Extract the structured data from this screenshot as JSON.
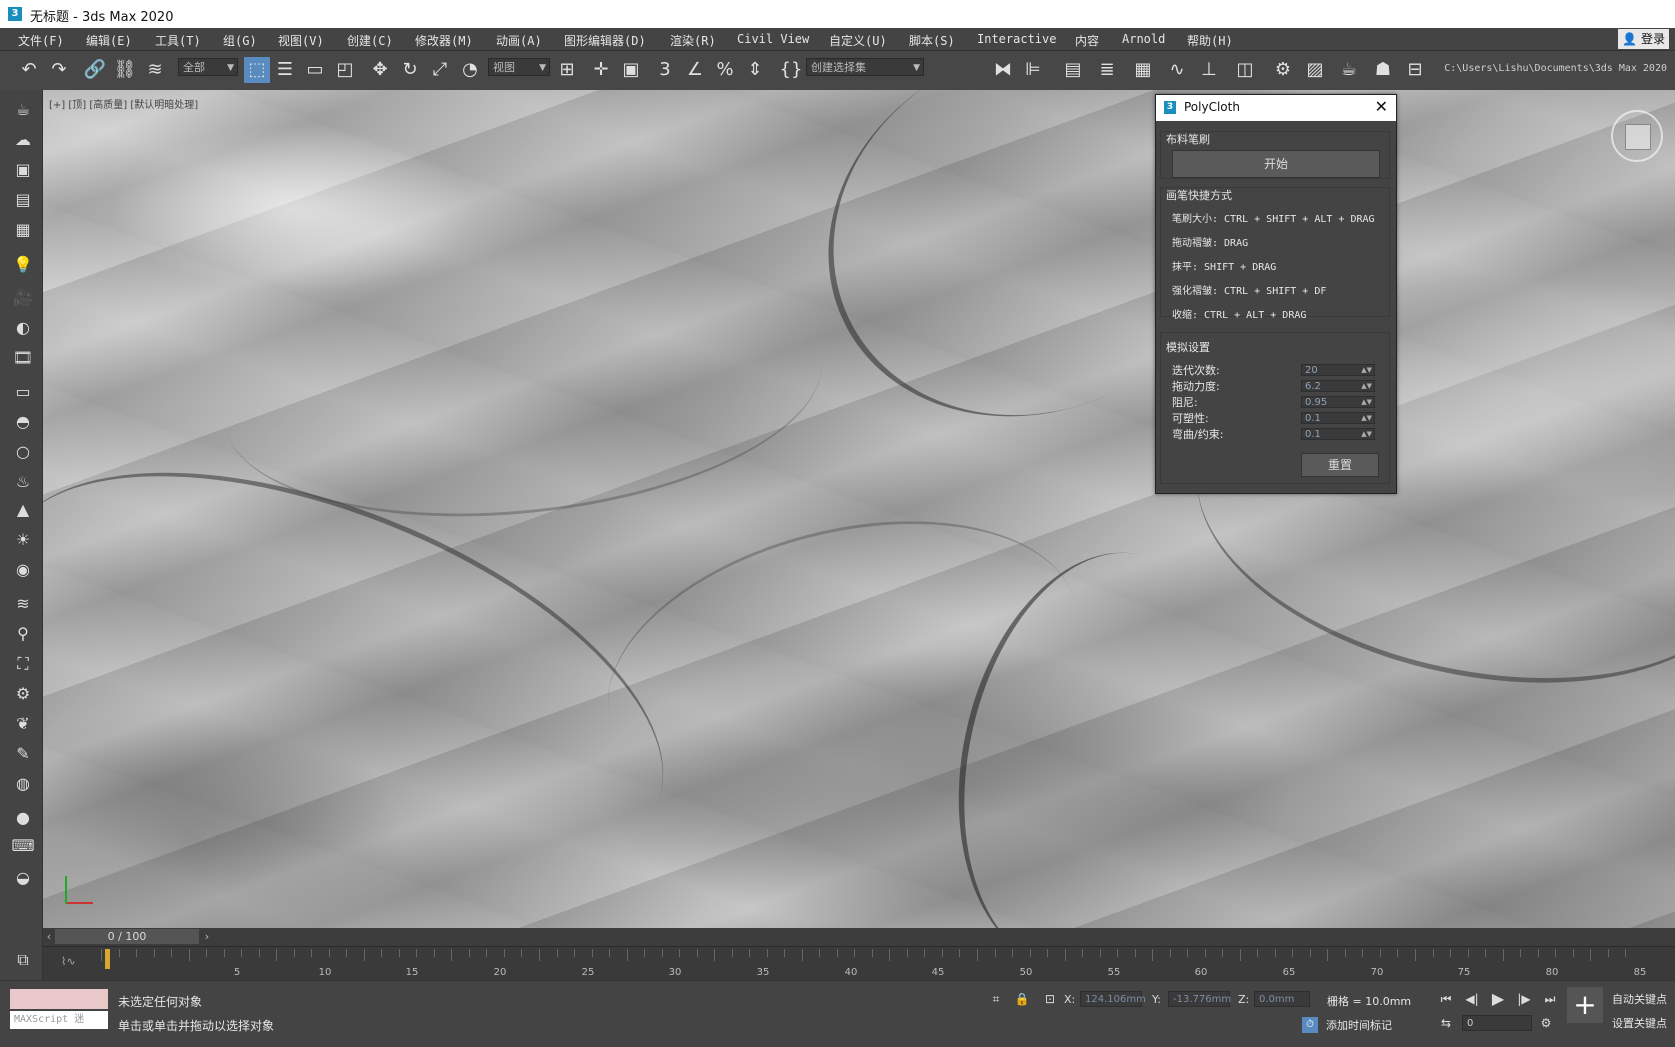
{
  "window": {
    "title": "无标题 - 3ds Max 2020",
    "login": "登录"
  },
  "menu": [
    "文件(F)",
    "编辑(E)",
    "工具(T)",
    "组(G)",
    "视图(V)",
    "创建(C)",
    "修改器(M)",
    "动画(A)",
    "图形编辑器(D)",
    "渲染(R)",
    "Civil View",
    "自定义(U)",
    "脚本(S)",
    "Interactive",
    "内容",
    "Arnold",
    "帮助(H)"
  ],
  "toolbar": {
    "selection_filter": "全部",
    "ref_coord": "视图",
    "named_selection": "创建选择集",
    "project_path": "C:\\Users\\Lishu\\Documents\\3ds Max 2020"
  },
  "viewport": {
    "label": "[+] [顶] [高质量] [默认明暗处理]"
  },
  "polycloth": {
    "title": "PolyCloth",
    "brush_section": "布料笔刷",
    "start_button": "开始",
    "shortcuts_section": "画笔快捷方式",
    "shortcuts": [
      "笔刷大小: CTRL + SHIFT + ALT + DRAG",
      "拖动褶皱: DRAG",
      "抹平: SHIFT + DRAG",
      "强化褶皱: CTRL + SHIFT + DF",
      "收缩: CTRL + ALT + DRAG"
    ],
    "sim_section": "模拟设置",
    "params": [
      {
        "name": "迭代次数:",
        "value": "20"
      },
      {
        "name": "拖动力度:",
        "value": "6.2"
      },
      {
        "name": "阻尼:",
        "value": "0.95"
      },
      {
        "name": "可塑性:",
        "value": "0.1"
      },
      {
        "name": "弯曲/约束:",
        "value": "0.1"
      }
    ],
    "reset_button": "重置"
  },
  "timeline": {
    "frame": "0 / 100",
    "ticks": [
      "5",
      "10",
      "15",
      "20",
      "25",
      "30",
      "35",
      "40",
      "45",
      "50",
      "55",
      "60",
      "65",
      "70",
      "75",
      "80",
      "85"
    ]
  },
  "status": {
    "maxscript_placeholder": "MAXScript 迷",
    "selection": "未选定任何对象",
    "prompt": "单击或单击并拖动以选择对象",
    "x_label": "X:",
    "x": "124.106mm",
    "y_label": "Y:",
    "y": "-13.776mm",
    "z_label": "Z:",
    "z": "0.0mm",
    "grid": "栅格 = 10.0mm",
    "add_time_tag": "添加时间标记",
    "auto_key": "自动关键点",
    "set_key": "设置关键点",
    "frame_field": "0"
  }
}
